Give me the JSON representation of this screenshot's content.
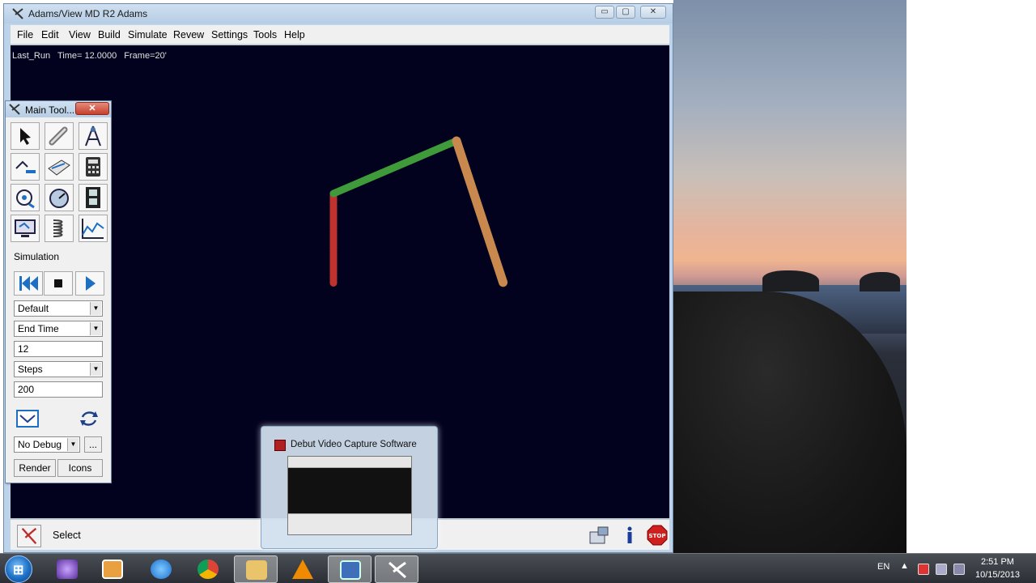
{
  "window": {
    "title": "Adams/View MD R2 Adams",
    "minimize_glyph": "▭",
    "maximize_glyph": "▢",
    "close_glyph": "✕"
  },
  "menu": {
    "items": [
      "File",
      "Edit",
      "View",
      "Build",
      "Simulate",
      "Revew",
      "Settings",
      "Tools",
      "Help"
    ]
  },
  "viewport": {
    "run_name": "Last_Run",
    "time_text": "Time= 12.0000",
    "frame_text": "Frame=20'"
  },
  "toolbox": {
    "title": "Main Tool...",
    "close_glyph": "✕",
    "section_label": "Simulation",
    "sim_type": "Default",
    "end_mode": "End Time",
    "end_value": "12",
    "steps_mode": "Steps",
    "steps_value": "200",
    "debug_mode": "No Debug",
    "more_label": "...",
    "render_label": "Render",
    "icons_label": "Icons"
  },
  "status": {
    "text": "Select"
  },
  "preview": {
    "title": "Debut Video Capture Software"
  },
  "tray": {
    "language": "EN",
    "time": "2:51 PM",
    "date": "10/15/2013"
  },
  "colors": {
    "viewport_bg": "#02021f",
    "link_ground_red": "#c0322e",
    "link_crank_green": "#3f9a3a",
    "link_rocker_orange": "#c9894e",
    "accent_blue": "#1d6fc4"
  }
}
